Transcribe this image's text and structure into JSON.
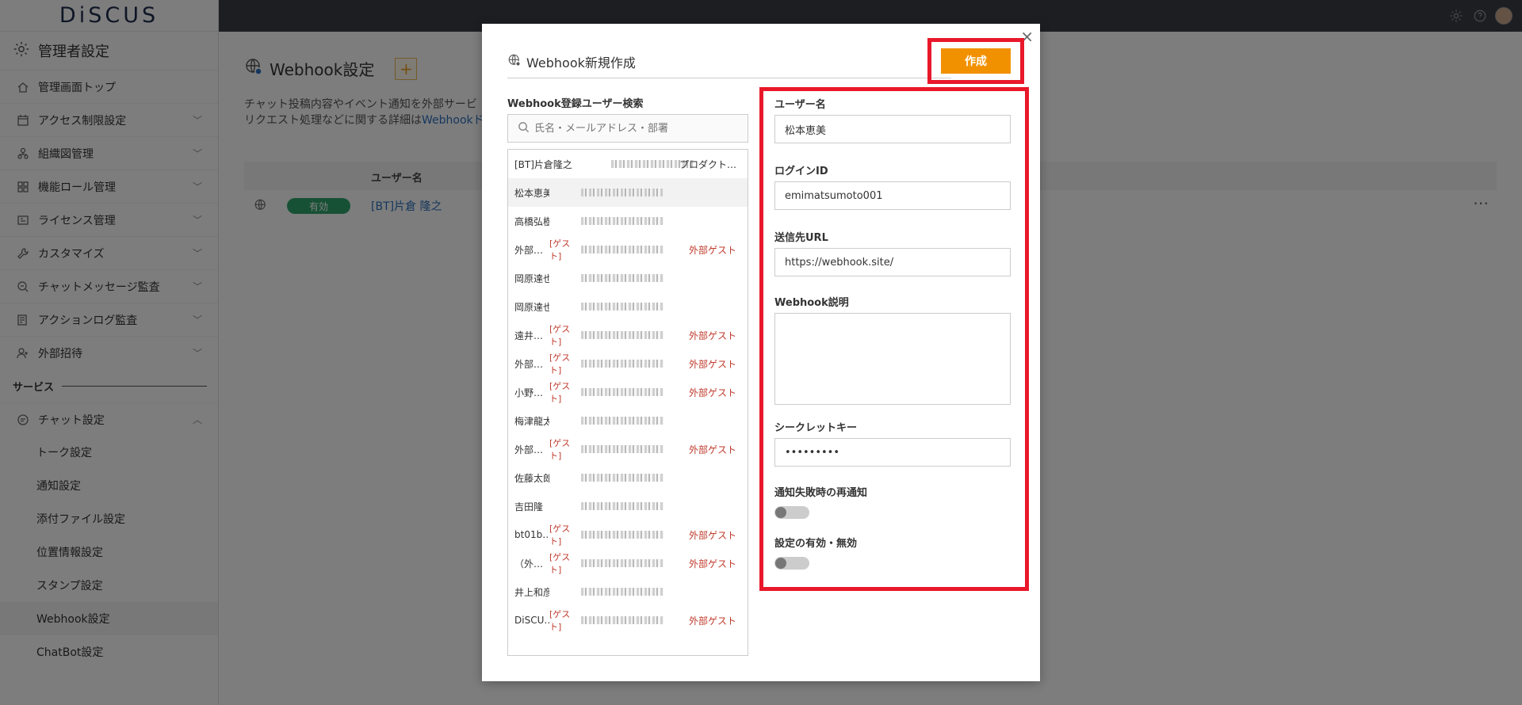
{
  "app": {
    "logo": "DiSCUS"
  },
  "sidebar": {
    "header": "管理者設定",
    "items": [
      {
        "label": "管理画面トップ",
        "icon": "home-icon",
        "expandable": false
      },
      {
        "label": "アクセス制限設定",
        "icon": "calendar-lock-icon",
        "expandable": true
      },
      {
        "label": "組織図管理",
        "icon": "org-chart-icon",
        "expandable": true
      },
      {
        "label": "機能ロール管理",
        "icon": "grid-icon",
        "expandable": true
      },
      {
        "label": "ライセンス管理",
        "icon": "license-icon",
        "expandable": true
      },
      {
        "label": "カスタマイズ",
        "icon": "wrench-icon",
        "expandable": true
      },
      {
        "label": "チャットメッセージ監査",
        "icon": "chat-audit-icon",
        "expandable": true
      },
      {
        "label": "アクションログ監査",
        "icon": "log-audit-icon",
        "expandable": true
      },
      {
        "label": "外部招待",
        "icon": "invite-icon",
        "expandable": true
      }
    ],
    "section": "サービス",
    "chat_settings": "チャット設定",
    "sub_items": [
      {
        "label": "トーク設定"
      },
      {
        "label": "通知設定"
      },
      {
        "label": "添付ファイル設定"
      },
      {
        "label": "位置情報設定"
      },
      {
        "label": "スタンプ設定"
      },
      {
        "label": "Webhook設定"
      },
      {
        "label": "ChatBot設定"
      }
    ]
  },
  "main": {
    "title": "Webhook設定",
    "add_label": "+",
    "desc_line1": "チャット投稿内容やイベント通知を外部サービ",
    "desc_line2_prefix": "リクエスト処理などに関する詳細は",
    "desc_link": "Webhookド",
    "table_col_user": "ユーザー名",
    "row": {
      "status": "有効",
      "user": "[BT]片倉 隆之",
      "more": "⋯"
    }
  },
  "modal": {
    "title": "Webhook新規作成",
    "create_label": "作成",
    "close": "×",
    "search_label": "Webhook登録ユーザー検索",
    "search_placeholder": "氏名・メールアドレス・部署",
    "users": [
      {
        "name": "[BT]片倉隆之",
        "guest": "",
        "tag": "プロダクト…",
        "wide": true
      },
      {
        "name": "松本恵美",
        "guest": "",
        "tag": "",
        "wide": false
      },
      {
        "name": "高橋弘樹",
        "guest": "",
        "tag": "",
        "wide": false
      },
      {
        "name": "外部…",
        "guest": "[ゲスト]",
        "tag": "外部ゲスト",
        "wide": false
      },
      {
        "name": "岡原達也",
        "guest": "",
        "tag": "",
        "wide": false
      },
      {
        "name": "岡原達也",
        "guest": "",
        "tag": "",
        "wide": false
      },
      {
        "name": "遠井…",
        "guest": "[ゲスト]",
        "tag": "外部ゲスト",
        "wide": false
      },
      {
        "name": "外部…",
        "guest": "[ゲスト]",
        "tag": "外部ゲスト",
        "wide": false
      },
      {
        "name": "小野…",
        "guest": "[ゲスト]",
        "tag": "外部ゲスト",
        "wide": false
      },
      {
        "name": "梅津龍太",
        "guest": "",
        "tag": "",
        "wide": false
      },
      {
        "name": "外部…",
        "guest": "[ゲスト]",
        "tag": "外部ゲスト",
        "wide": false
      },
      {
        "name": "佐藤太郎",
        "guest": "",
        "tag": "",
        "wide": false
      },
      {
        "name": "吉田隆",
        "guest": "",
        "tag": "",
        "wide": false
      },
      {
        "name": "bt01b…",
        "guest": "[ゲスト]",
        "tag": "外部ゲスト",
        "wide": false
      },
      {
        "name": "（外…",
        "guest": "[ゲスト]",
        "tag": "外部ゲスト",
        "wide": false
      },
      {
        "name": "井上和彦",
        "guest": "",
        "tag": "",
        "wide": false
      },
      {
        "name": "DiSCU…",
        "guest": "[ゲスト]",
        "tag": "外部ゲスト",
        "wide": false
      }
    ],
    "form": {
      "username_label": "ユーザー名",
      "username_value": "松本恵美",
      "login_label": "ログインID",
      "login_value": "emimatsumoto001",
      "url_label": "送信先URL",
      "url_value": "https://webhook.site/",
      "desc_label": "Webhook説明",
      "secret_label": "シークレットキー",
      "secret_value": "•••••••••",
      "renotify_label": "通知失敗時の再通知",
      "enabled_label": "設定の有効・無効"
    }
  },
  "colors": {
    "accent": "#f29100",
    "highlight": "#e8182a",
    "active_badge": "#2ea36b",
    "link": "#2a6ebb"
  }
}
